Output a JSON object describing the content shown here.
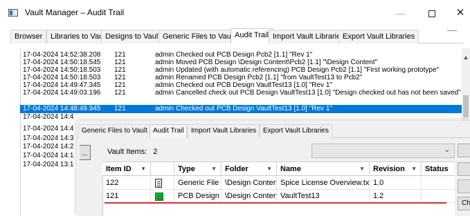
{
  "window": {
    "title": "Vault Manager – Audit Trail",
    "minimize": "—",
    "close": "✕"
  },
  "tabs": [
    {
      "label": "Browser",
      "active": false
    },
    {
      "label": "Libraries to Vault",
      "active": false
    },
    {
      "label": "Designs to Vault",
      "active": false
    },
    {
      "label": "Generic Files to Vault",
      "active": false
    },
    {
      "label": "Audit Trail",
      "active": true
    },
    {
      "label": "Import Vault Libraries",
      "active": false
    },
    {
      "label": "Export Vault Libraries",
      "active": false
    }
  ],
  "log": [
    {
      "ts": "17-04-2024 14:52:38.208",
      "id": "121",
      "msg": "admin Checked out PCB Design Pcb2 [1.1] \"Rev 1\""
    },
    {
      "ts": "17-04-2024 14:50:18.545",
      "id": "121",
      "msg": "admin Moved PCB Design \\Design Content\\Pcb2 [1.1] \"\\Design Content\""
    },
    {
      "ts": "17-04-2024 14:50:18.503",
      "id": "121",
      "msg": "admin Updated (with automatic referencing) PCB Design Pcb2 [1.1] \"First working prototype\""
    },
    {
      "ts": "17-04-2024 14:50:18.503",
      "id": "121",
      "msg": "admin Renamed PCB Design Pcb2 [1.1] \"from VaultTest13 to Pcb2\""
    },
    {
      "ts": "17-04-2024 14:49:47.345",
      "id": "121",
      "msg": "admin Checked out PCB Design VaultTest13 [1.0] \"Rev 1\""
    },
    {
      "ts": "17-04-2024 14:49:03.196",
      "id": "121",
      "msg": "admin Cancelled check out PCB Design VaultTest13 [1.0] \"Design checked out has not been saved\""
    },
    {
      "ts": "17-04-2024 14:48:49.945",
      "id": "121",
      "msg": "admin Checked out PCB Design VaultTest13 [1.0] \"Rev 1\"",
      "selected": true
    },
    {
      "ts": "17-04-2024 14:4",
      "id": "",
      "msg": ""
    },
    {
      "ts": "17-04-2024 14:4",
      "id": "",
      "msg": ""
    },
    {
      "ts": "17-04-2024 14:3",
      "id": "",
      "msg": ""
    },
    {
      "ts": "17-04-2024 14:2",
      "id": "",
      "msg": ""
    },
    {
      "ts": "17-04-2024 14:1",
      "id": "",
      "msg": ""
    },
    {
      "ts": "17-04-2024 13:1",
      "id": "",
      "msg": ""
    }
  ],
  "dialog": {
    "tabs": [
      {
        "label": "Generic Files to Vault",
        "active": false
      },
      {
        "label": "Audit Trail",
        "active": true
      },
      {
        "label": "Import Vault Libraries",
        "active": false
      },
      {
        "label": "Export Vault Libraries",
        "active": false
      }
    ],
    "items_label": "Vault Items:",
    "items_count": "2",
    "combo_value": "",
    "side_button_label": "Ch",
    "columns": [
      "Item ID",
      "",
      "Type",
      "Folder",
      "Name",
      "Revision",
      "Status"
    ],
    "rows": [
      {
        "id": "122",
        "icon": "generic-file-icon",
        "type": "Generic File",
        "folder": "\\Design Content",
        "name": "Spice License Overview.txt",
        "revision": "1.0",
        "status": ""
      },
      {
        "id": "121",
        "icon": "pcb-design-icon",
        "type": "PCB Design",
        "folder": "\\Design Content",
        "name": "VaultTest13",
        "revision": "1.2",
        "status": ""
      }
    ]
  },
  "colors": {
    "selection": "#0078d7",
    "accent_line": "#d03030",
    "pcb_icon": "#1fae3b"
  }
}
